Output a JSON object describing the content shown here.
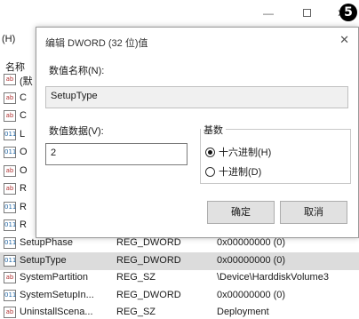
{
  "background": {
    "menu_partial": "(H)",
    "badge": "❺",
    "list_header_name": "名称",
    "left_rows": [
      {
        "icon": "ab",
        "name": "(默"
      },
      {
        "icon": "ab",
        "name": "C"
      },
      {
        "icon": "ab",
        "name": "C"
      },
      {
        "icon": "bin",
        "name": "L"
      },
      {
        "icon": "bin",
        "name": "O"
      },
      {
        "icon": "ab",
        "name": "O"
      },
      {
        "icon": "ab",
        "name": "R"
      },
      {
        "icon": "bin",
        "name": "R"
      },
      {
        "icon": "bin",
        "name": "R"
      }
    ],
    "rows": [
      {
        "icon": "bin",
        "name": "SetupPhase",
        "type": "REG_DWORD",
        "data": "0x00000000 (0)"
      },
      {
        "icon": "bin",
        "name": "SetupType",
        "type": "REG_DWORD",
        "data": "0x00000000 (0)"
      },
      {
        "icon": "ab",
        "name": "SystemPartition",
        "type": "REG_SZ",
        "data": "\\Device\\HarddiskVolume3"
      },
      {
        "icon": "bin",
        "name": "SystemSetupIn...",
        "type": "REG_DWORD",
        "data": "0x00000000 (0)"
      },
      {
        "icon": "ab",
        "name": "UninstallScena...",
        "type": "REG_SZ",
        "data": "Deployment"
      }
    ]
  },
  "dialog": {
    "title": "编辑 DWORD (32 位)值",
    "value_name_label": "数值名称(N):",
    "value_name": "SetupType",
    "value_data_label": "数值数据(V):",
    "value_data": "2",
    "base_label": "基数",
    "radio_hex": "十六进制(H)",
    "radio_dec": "十进制(D)",
    "selected_base": "hex",
    "ok": "确定",
    "cancel": "取消"
  }
}
